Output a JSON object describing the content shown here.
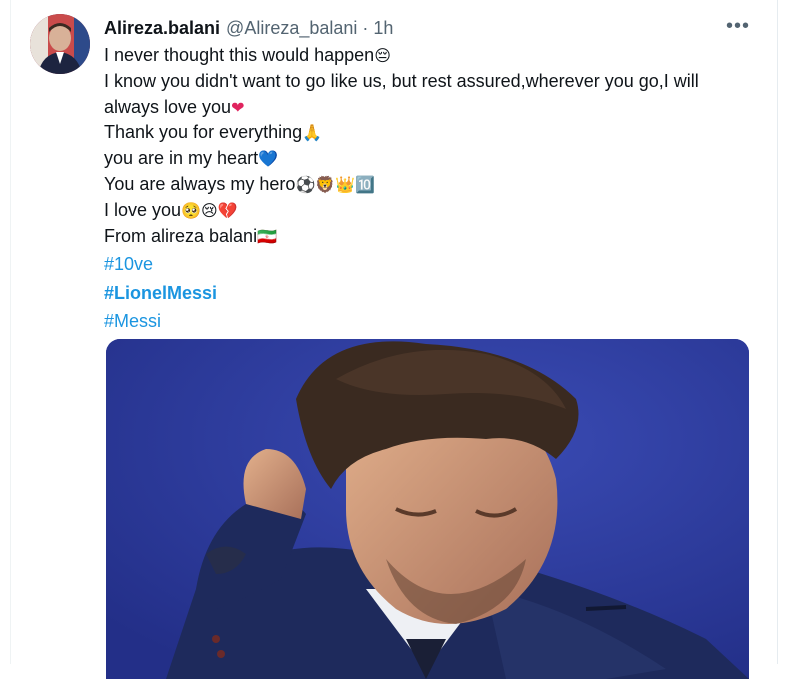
{
  "tweet": {
    "display_name": "Alireza.balani",
    "handle": "@Alireza_balani",
    "separator": "·",
    "time": "1h",
    "more_icon": "more-horizontal-icon",
    "lines": [
      {
        "text": "I never thought this would happen",
        "emoji": "😔"
      },
      {
        "text": "I know you didn't want to go like us, but rest assured,wherever you go,I will always love you",
        "emoji": "❤"
      },
      {
        "text": "Thank you for everything",
        "emoji": "🙏"
      },
      {
        "text": "you are in my heart",
        "emoji": "💙"
      },
      {
        "text": "You are always my hero",
        "emoji": "⚽🦁👑🔟"
      },
      {
        "text": "I love you",
        "emoji": "🥺😢💔"
      },
      {
        "text": "From alireza balani",
        "emoji": "🇮🇷"
      }
    ],
    "hashtags": [
      "#10ve",
      "#LionelMessi",
      "#Messi"
    ]
  },
  "colors": {
    "link": "#1b95e0",
    "muted": "#536471",
    "text": "#0f1419",
    "photo_bg": "#2b3a9c"
  }
}
